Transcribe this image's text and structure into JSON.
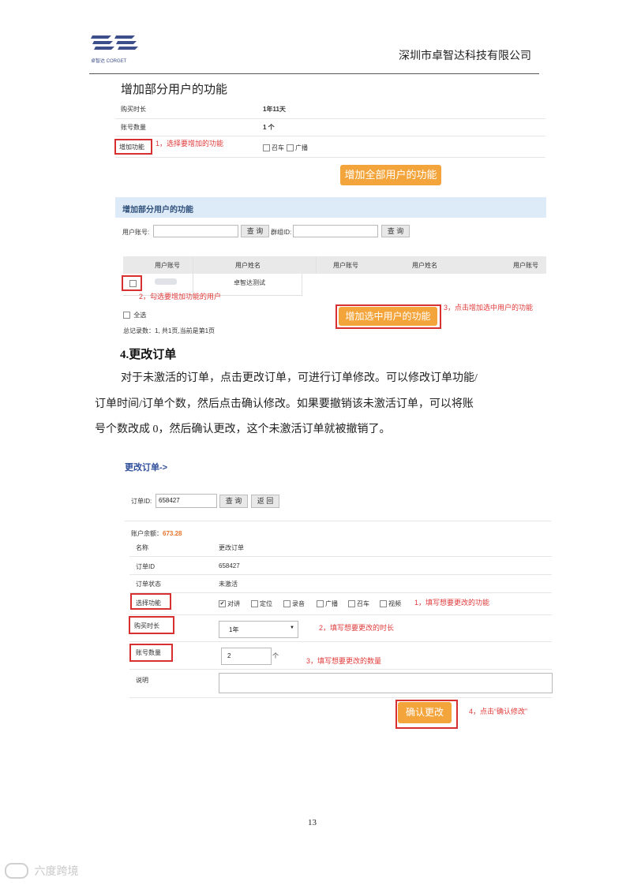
{
  "header": {
    "logo_text": "卓智达 CORGET",
    "company": "深圳市卓智达科技有限公司"
  },
  "section1": {
    "title": "增加部分用户的功能",
    "rows": [
      {
        "label": "购买时长",
        "value": "1年11天"
      },
      {
        "label": "账号数量",
        "value": "1 个"
      },
      {
        "label": "增加功能",
        "value": ""
      }
    ],
    "note1": "1，选择要增加的功能",
    "checkboxes": [
      "召车",
      "广播"
    ],
    "add_all_button": "增加全部用户的功能"
  },
  "section2": {
    "panel_title": "增加部分用户的功能",
    "user_account_label": "用户账号:",
    "query_button": "查 询",
    "group_id_label": "群组ID:",
    "query_button2": "查 询",
    "columns": [
      "用户账号",
      "用户姓名",
      "用户账号",
      "用户姓名",
      "用户账号"
    ],
    "row_name": "卓智达测试",
    "note2": "2，勾选要增加功能的用户",
    "select_all": "全选",
    "summary": "总记录数：1, 共1页,当前是第1页",
    "add_selected_button": "增加选中用户的功能",
    "note3": "3，点击增加选中用户的功能"
  },
  "section4": {
    "heading": "4.更改订单",
    "para1": "对于未激活的订单，点击更改订单，可进行订单修改。可以修改订单功能/",
    "para2": "订单时间/订单个数，然后点击确认修改。如果要撤销该未激活订单，可以将账",
    "para3": "号个数改成 0，然后确认更改，这个未激活订单就被撤销了。"
  },
  "section5": {
    "title": "更改订单->",
    "order_id_label": "订单ID:",
    "order_id_value": "658427",
    "query_button": "查 询",
    "back_button": "返 回",
    "balance_label": "账户余额：",
    "balance_value": "673.28",
    "rows": [
      {
        "label": "名称",
        "value": "更改订单"
      },
      {
        "label": "订单ID",
        "value": "658427"
      },
      {
        "label": "订单状态",
        "value": "未激活"
      },
      {
        "label": "选择功能",
        "value": ""
      },
      {
        "label": "购买时长",
        "value": ""
      },
      {
        "label": "账号数量",
        "value": ""
      },
      {
        "label": "说明",
        "value": ""
      }
    ],
    "features": [
      "对讲",
      "定位",
      "录音",
      "广播",
      "召车",
      "视频"
    ],
    "feature_checked": [
      true,
      false,
      false,
      false,
      false,
      false
    ],
    "duration_value": "1年",
    "count_value": "2",
    "count_unit": "个",
    "note1": "1，填写想要更改的功能",
    "note2": "2，填写想要更改的时长",
    "note3": "3，填写想要更改的数量",
    "confirm_button": "确认更改",
    "note4": "4，点击“确认修改”"
  },
  "footer": {
    "page_number": "13",
    "watermark": "六度跨境"
  },
  "colors": {
    "accent_orange": "#f3a53c",
    "annotation_red": "#e03a3a",
    "panel_blue": "#dcebf7",
    "balance_orange": "#e8752a"
  }
}
